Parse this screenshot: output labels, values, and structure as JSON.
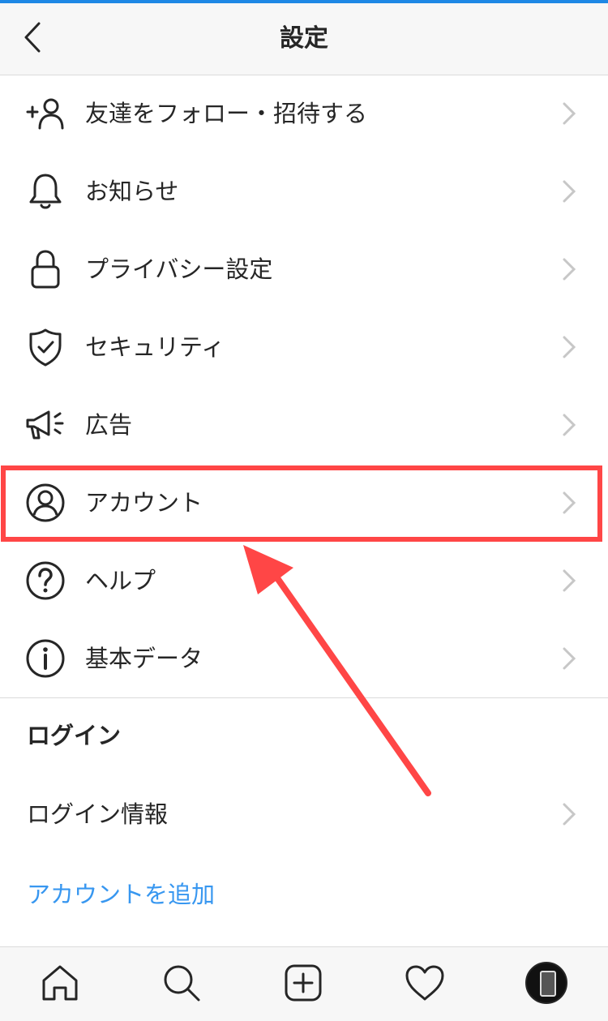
{
  "header": {
    "title": "設定"
  },
  "menu": {
    "items": [
      {
        "label": "友達をフォロー・招待する",
        "icon": "add-person-icon"
      },
      {
        "label": "お知らせ",
        "icon": "bell-icon"
      },
      {
        "label": "プライバシー設定",
        "icon": "lock-icon"
      },
      {
        "label": "セキュリティ",
        "icon": "shield-check-icon"
      },
      {
        "label": "広告",
        "icon": "megaphone-icon"
      },
      {
        "label": "アカウント",
        "icon": "account-circle-icon",
        "highlighted": true
      },
      {
        "label": "ヘルプ",
        "icon": "help-circle-icon"
      },
      {
        "label": "基本データ",
        "icon": "info-circle-icon"
      }
    ]
  },
  "login": {
    "section_title": "ログイン",
    "login_info_label": "ログイン情報",
    "add_account_label": "アカウントを追加"
  },
  "tabbar": {
    "tabs": [
      "home-icon",
      "search-icon",
      "add-post-icon",
      "heart-icon",
      "profile-avatar"
    ]
  },
  "colors": {
    "accent_blue": "#3897f0",
    "highlight_red": "#ff4646",
    "top_bar": "#1e88e5"
  }
}
